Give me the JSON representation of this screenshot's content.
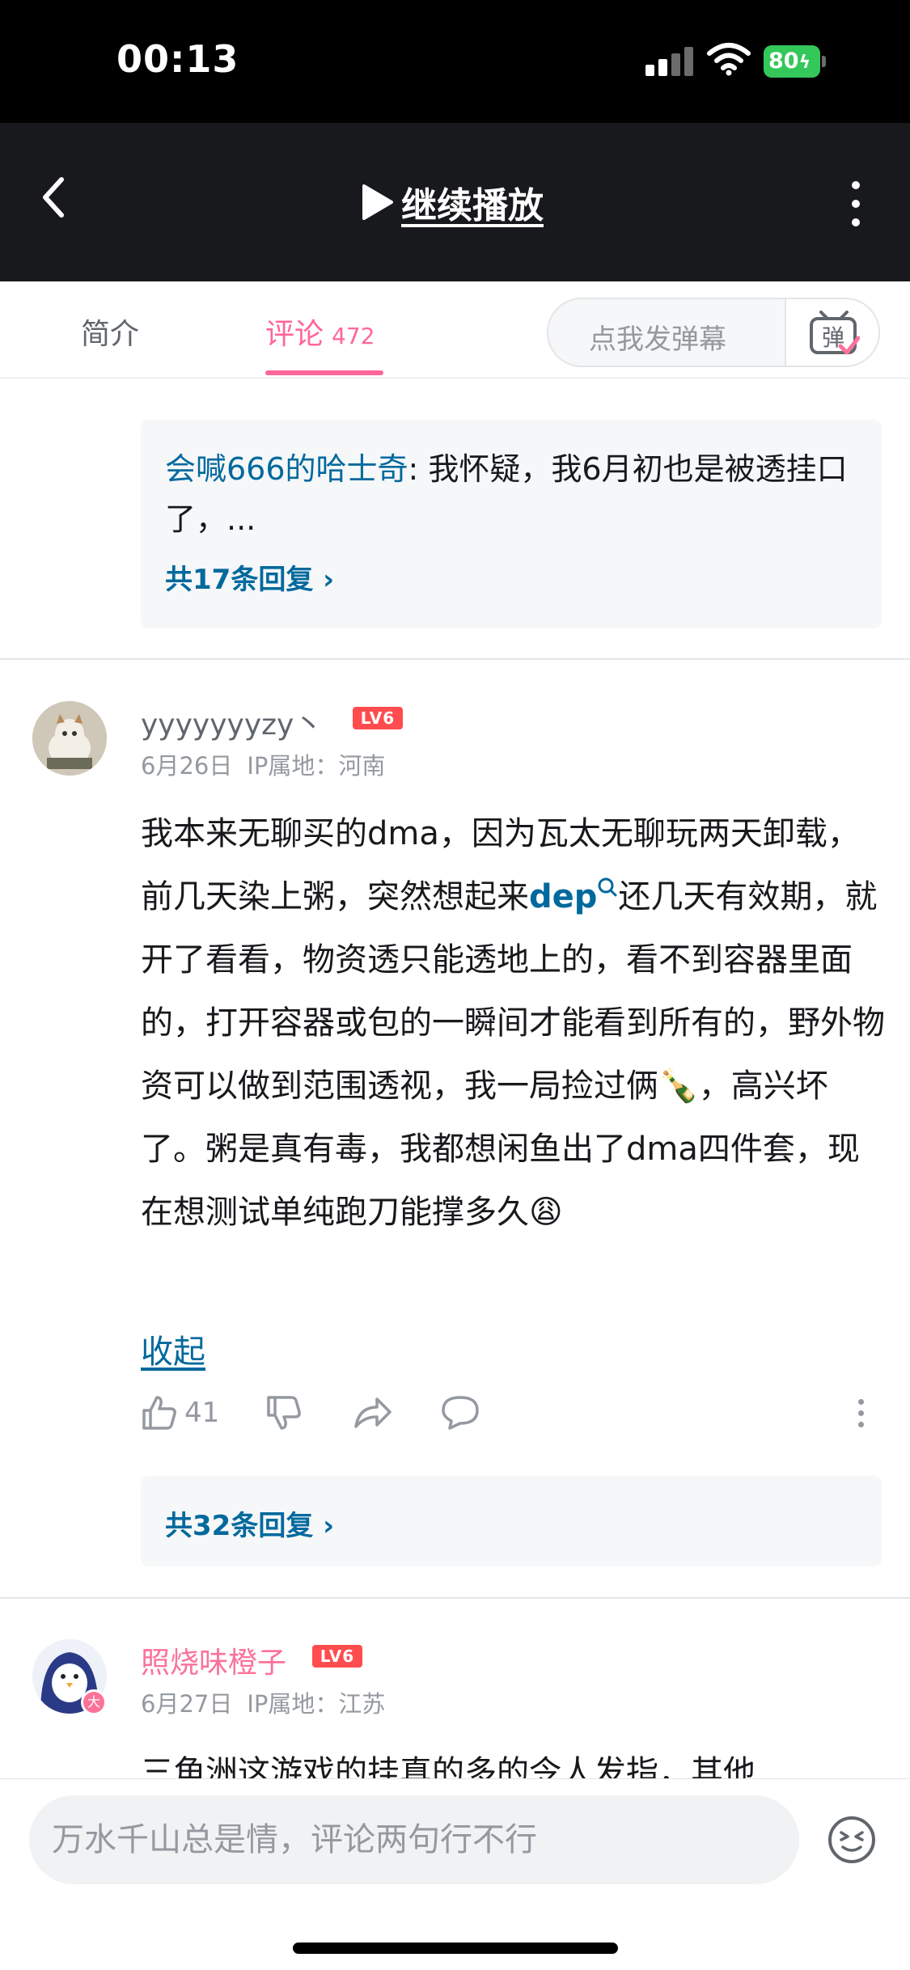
{
  "status": {
    "time": "00:13",
    "battery": "80"
  },
  "player": {
    "continue_label": "继续播放"
  },
  "tabs": {
    "intro": "简介",
    "comments": "评论",
    "comments_count": "472",
    "danmaku_placeholder": "点我发弹幕",
    "danmaku_icon": "弹"
  },
  "thread1": {
    "reply_user": "会喊666的哈士奇",
    "reply_text": ": 我怀疑，我6月初也是被透挂口了，...",
    "more_replies": "共17条回复 ›"
  },
  "comment1": {
    "username": "yyyyyyyzy丶",
    "level": "LV6",
    "date": "6月26日",
    "ip": "IP属地：河南",
    "text_part1": "我本来无聊买的dma，因为瓦太无聊玩两天卸载，前几天染上粥，突然想起来",
    "link": "dep",
    "text_part2": "还几天有效期，就开了看看，物资透只能透地上的，看不到容器里面的，打开容器或包的一瞬间才能看到所有的，野外物资可以做到范围透视，我一局捡过俩🍾，高兴坏了。粥是真有毒，我都想闲鱼出了dma四件套，现在想测试单纯跑刀能撑多久😩",
    "collapse": "收起",
    "likes": "41",
    "more_replies": "共32条回复 ›"
  },
  "comment2": {
    "username": "照烧味橙子",
    "level": "LV6",
    "date": "6月27日",
    "ip": "IP属地：江苏",
    "text": "三角洲这游戏的挂真的多的令人发指，其他"
  },
  "input": {
    "placeholder": "万水千山总是情，评论两句行不行"
  },
  "colors": {
    "accent": "#fb7299",
    "link": "#00699d"
  },
  "icons": [
    "back-icon",
    "play-icon",
    "more-icon",
    "like-icon",
    "dislike-icon",
    "share-icon",
    "reply-icon",
    "emoji-icon",
    "search-icon"
  ]
}
